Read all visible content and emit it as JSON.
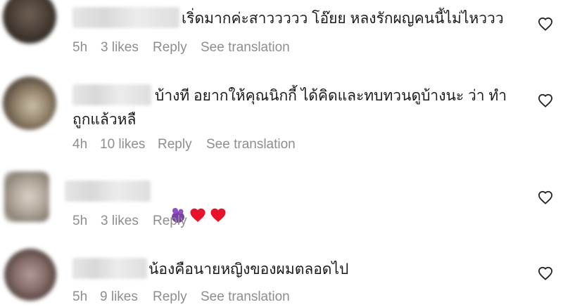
{
  "comments": [
    {
      "text": "เริ่ดมากค่ะสาววววว โอ๊ยย หลงรักผญคนนี้ไม่ไหววว",
      "time": "5h",
      "likes": "3 likes",
      "reply": "Reply",
      "translate": "See translation"
    },
    {
      "text": "บ้างที อยากให้คุณนิกกี้ ได้คิดและทบทวนดูบ้างนะ ว่า ทำ\nถูกแล้วหลื",
      "time": "4h",
      "likes": "10 likes",
      "reply": "Reply",
      "translate": "See translation"
    },
    {
      "time": "5h",
      "likes": "3 likes",
      "reply": "Reply"
    },
    {
      "text": "น้องคือนายหญิงของผมตลอดไป",
      "time": "5h",
      "likes": "9 likes",
      "reply": "Reply",
      "translate": "See translation"
    }
  ],
  "icons": {
    "like": "heart-outline-icon",
    "emoji_1": "purple-blob-emoji",
    "emoji_2": "red-heart-emoji"
  },
  "colors": {
    "text": "#1a1a1a",
    "meta": "#8e8e8e",
    "heart_emoji": "#e8132b",
    "blob_emoji": "#7a3fa8"
  }
}
